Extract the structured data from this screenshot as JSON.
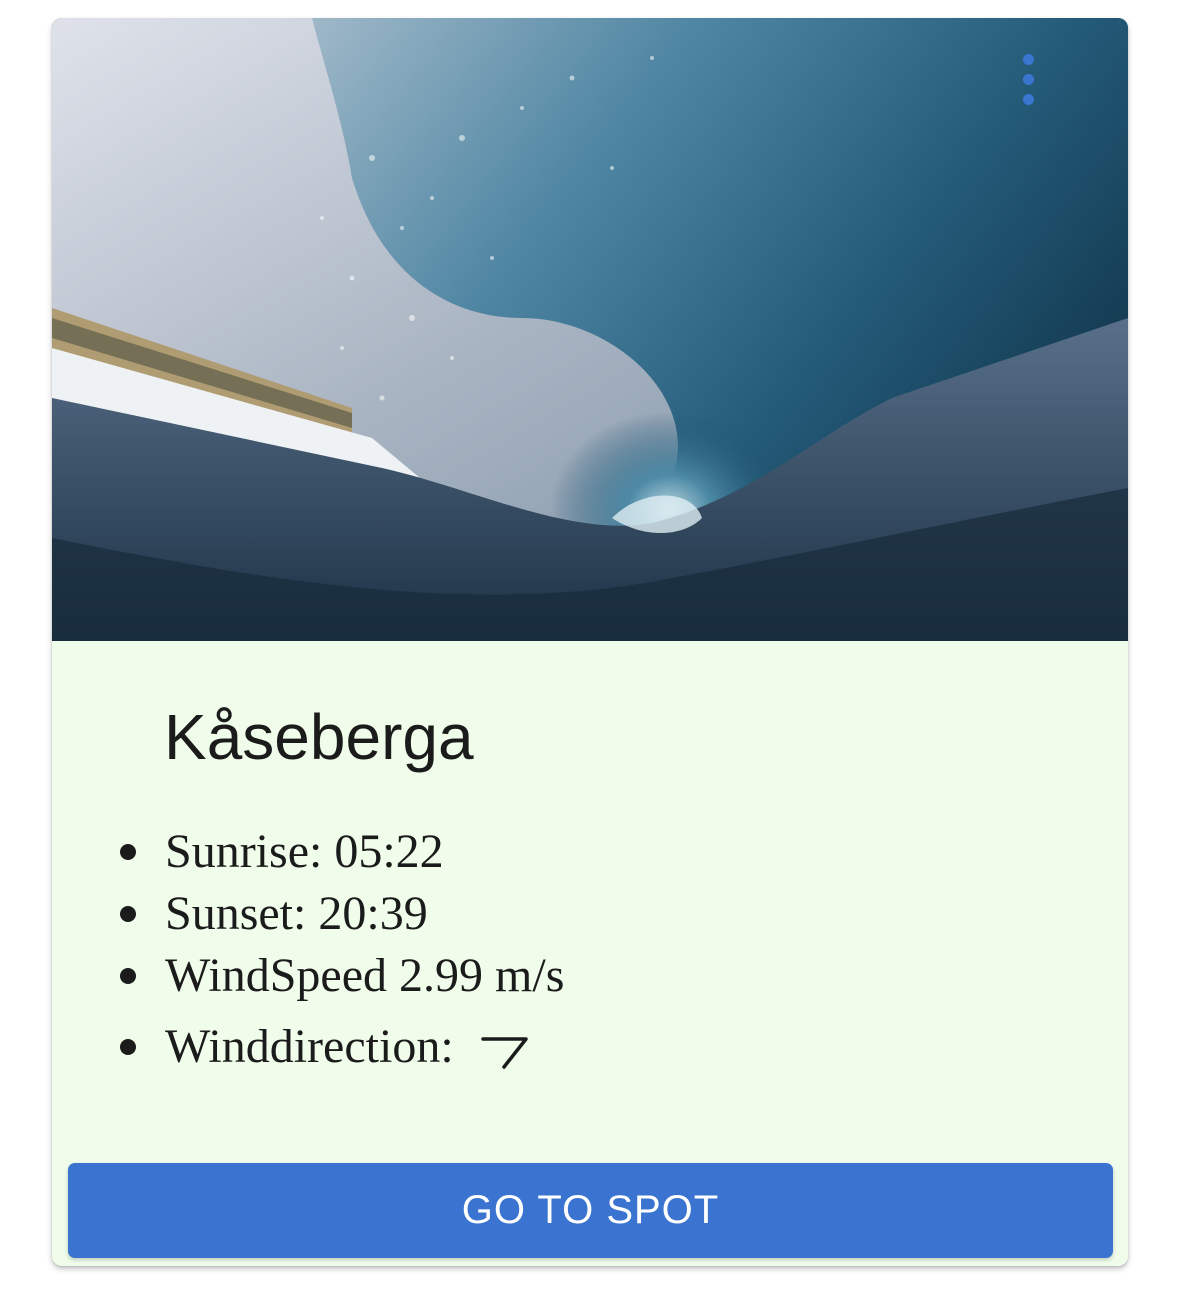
{
  "card": {
    "image_alt": "Ocean wave",
    "title": "Kåseberga",
    "info": [
      {
        "label": "Sunrise: 05:22"
      },
      {
        "label": "Sunset: 20:39"
      },
      {
        "label": "WindSpeed 2.99 m/s"
      },
      {
        "label": "Winddirection:",
        "arrow_icon": "wind-direction-arrow-icon"
      }
    ],
    "action_label": "GO TO SPOT",
    "menu_icon": "more-vertical-icon"
  },
  "colors": {
    "card_background": "#f0fdeb",
    "button_background": "#3a74d0",
    "button_text": "#ffffff",
    "menu_icon": "#3a76d0",
    "text": "#1b1b1b"
  }
}
